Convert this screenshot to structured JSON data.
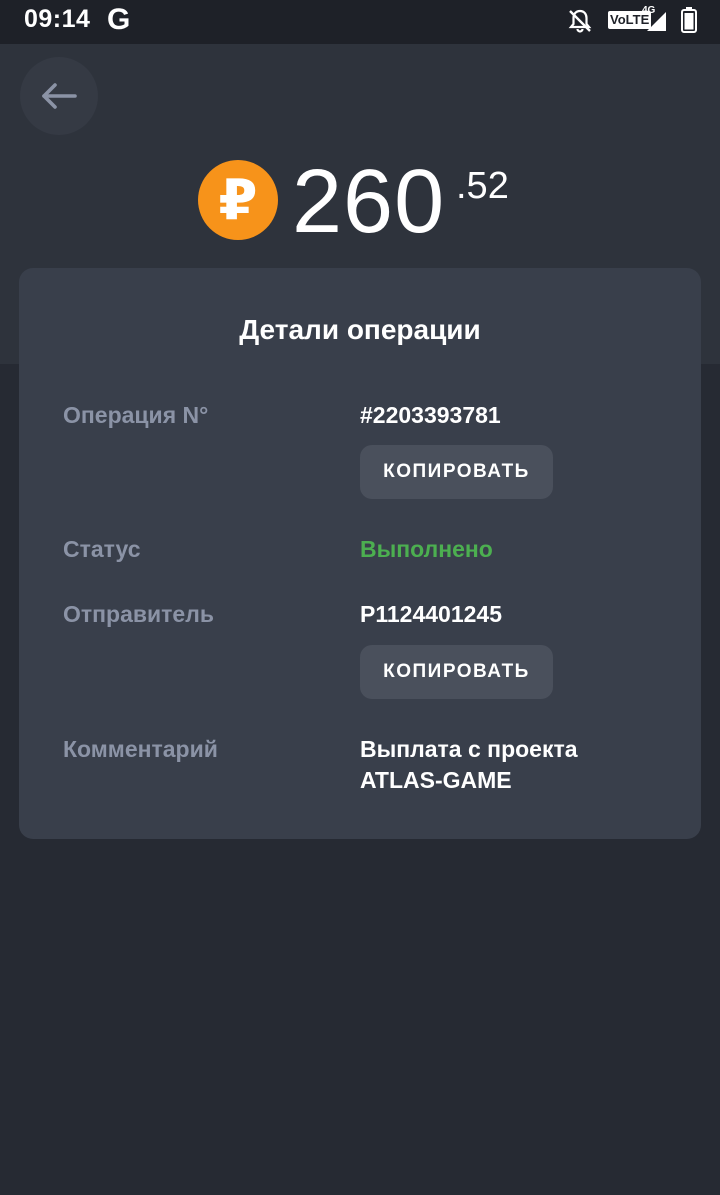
{
  "status_bar": {
    "time": "09:14",
    "app_icon": "G",
    "volte": "VoLTE",
    "network": "4G"
  },
  "header": {
    "back_icon": "arrow-left-icon",
    "currency_symbol": "₽",
    "balance_int": "260",
    "balance_frac": ".52",
    "coin_color": "#f7931a"
  },
  "card": {
    "title": "Детали операции",
    "rows": [
      {
        "label": "Операция N°",
        "value": "#2203393781",
        "button": "КОПИРОВАТЬ"
      },
      {
        "label": "Статус",
        "value": "Выполнено",
        "value_color": "#4caf50"
      },
      {
        "label": "Отправитель",
        "value": "P1124401245",
        "button": "КОПИРОВАТЬ"
      },
      {
        "label": "Комментарий",
        "value_line1": "Выплата с проекта",
        "value_line2": "ATLAS-GAME"
      }
    ]
  }
}
